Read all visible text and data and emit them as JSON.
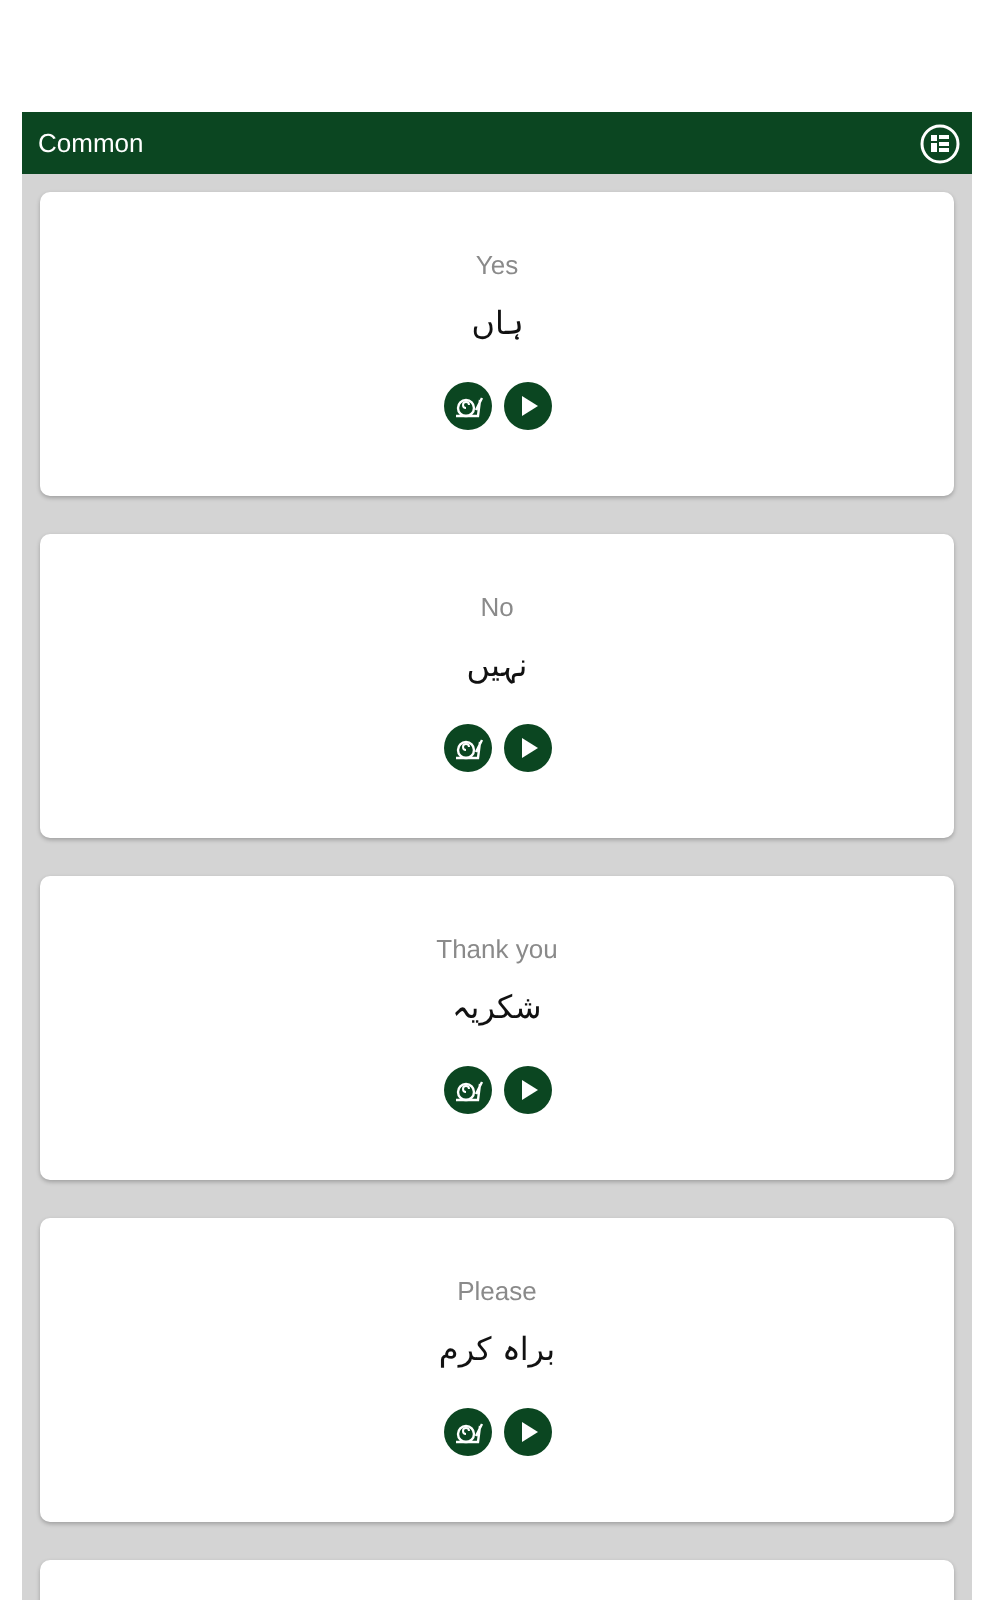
{
  "app_bar": {
    "title": "Common"
  },
  "phrases": [
    {
      "english": "Yes",
      "urdu": "ہاں"
    },
    {
      "english": "No",
      "urdu": "نہیں"
    },
    {
      "english": "Thank you",
      "urdu": "شکریہ"
    },
    {
      "english": "Please",
      "urdu": "براہ کرم"
    }
  ],
  "more_below": true
}
